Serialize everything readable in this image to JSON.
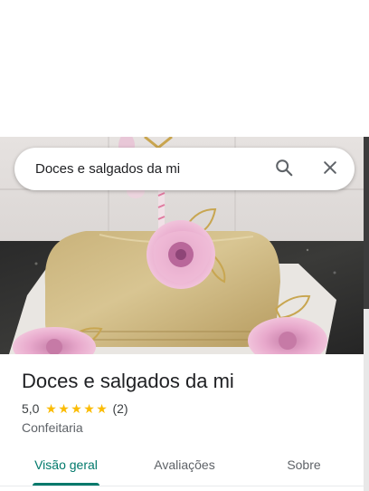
{
  "search": {
    "value": "Doces e salgados da mi",
    "search_icon": "search-icon",
    "clear_icon": "close-icon"
  },
  "place": {
    "name": "Doces e salgados da mi",
    "rating": "5,0",
    "stars_filled": 5,
    "review_count": "(2)",
    "category": "Confeitaria"
  },
  "tabs": [
    {
      "label": "Visão geral",
      "active": true
    },
    {
      "label": "Avaliações",
      "active": false
    },
    {
      "label": "Sobre",
      "active": false
    }
  ],
  "colors": {
    "accent": "#00796b",
    "star": "#fbbc04"
  }
}
